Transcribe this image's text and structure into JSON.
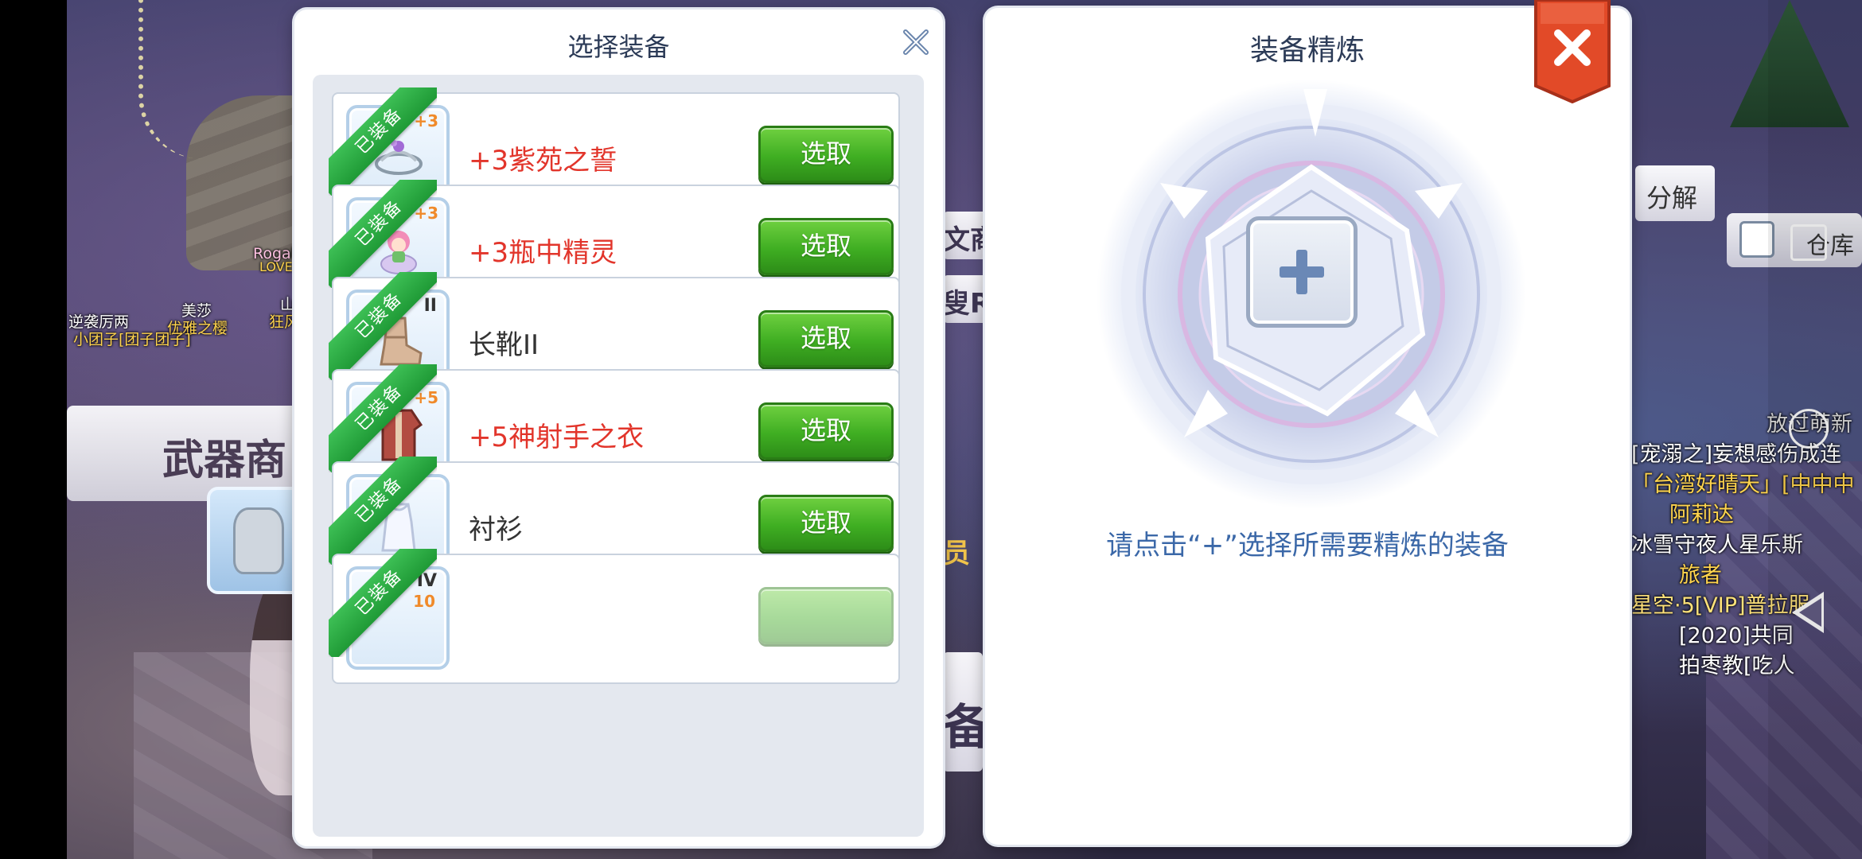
{
  "background": {
    "shop_sign": "武器商",
    "frag_wenshang": "文商",
    "frag_sou": "叟R",
    "frag_yuan": "员",
    "frag_bei": "备",
    "frag_jie": "分解",
    "frag_cangku": "仓库",
    "nametags": {
      "t1": "Rogal",
      "t2": "LOVELI",
      "t3": "美莎",
      "t4": "优雅之樱",
      "t5": "小团子[团子团子]",
      "t6": "山",
      "t7": "狂风",
      "t8": "逆袭厉两"
    },
    "chat": {
      "l0": "放过萌新",
      "l1": "[宠溺之]妄想感伤成连",
      "l2": "「台湾好晴天」[中中中",
      "l3": "阿莉达",
      "l4": "冰雪守夜人星乐斯",
      "l5": "旅者",
      "l6": "星空·5[VIP]普拉服",
      "l7": "[2020]共同",
      "l8": "拍枣教[吃人"
    }
  },
  "select_panel": {
    "title": "选择装备",
    "equipped_label": "已装备",
    "items": [
      {
        "name": "+3紫苑之誓",
        "refine": "+3",
        "tier": "",
        "refined": true,
        "button": "选取"
      },
      {
        "name": "+3瓶中精灵",
        "refine": "+3",
        "tier": "",
        "refined": true,
        "button": "选取"
      },
      {
        "name": "长靴II",
        "refine": "",
        "tier": "II",
        "refined": false,
        "button": "选取"
      },
      {
        "name": "+5神射手之衣",
        "refine": "+5",
        "tier": "",
        "refined": true,
        "button": "选取"
      },
      {
        "name": "衬衫",
        "refine": "",
        "tier": "",
        "refined": false,
        "button": "选取"
      },
      {
        "name": "",
        "refine": "10",
        "tier": "IV",
        "refined": false,
        "button": ""
      }
    ]
  },
  "refine_panel": {
    "title": "装备精炼",
    "hint": "请点击“+”选择所需要精炼的装备"
  },
  "colors": {
    "accent_green": "#3fae22",
    "refined_red": "#e2352b",
    "ribbon_green": "#2aaa45",
    "close_red": "#e24a28",
    "hint_blue": "#3b68a8"
  }
}
